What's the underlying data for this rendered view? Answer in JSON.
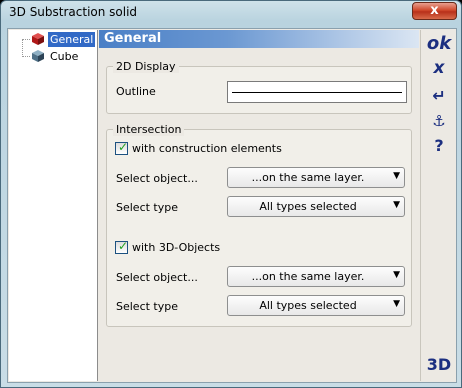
{
  "window": {
    "title": "3D Substraction solid",
    "close_label": "x"
  },
  "tree": {
    "items": [
      {
        "label": "General",
        "selected": true,
        "icon": "red-cube-icon"
      },
      {
        "label": "Cube",
        "selected": false,
        "icon": "blue-cube-icon"
      }
    ]
  },
  "panel": {
    "title": "General",
    "display_group": {
      "legend": "2D Display",
      "outline_label": "Outline"
    },
    "intersection_group": {
      "legend": "Intersection",
      "construction": {
        "checkbox_label": "with construction elements",
        "checked": true,
        "select_object_label": "Select object...",
        "select_object_value": "...on the same layer.",
        "select_type_label": "Select type",
        "select_type_value": "All types selected"
      },
      "objects3d": {
        "checkbox_label": "with 3D-Objects",
        "checked": true,
        "select_object_label": "Select object...",
        "select_object_value": "...on the same layer.",
        "select_type_label": "Select type",
        "select_type_value": "All types selected"
      }
    }
  },
  "toolbar": {
    "ok_label": "ok",
    "cancel_label": "x",
    "enter_icon": "↵",
    "anchor_icon": "⚓",
    "help_label": "?",
    "mode_label": "3D"
  },
  "colors": {
    "header_blue": "#4a7fc6",
    "toolbar_text": "#1c2f80",
    "selection": "#3169c6"
  }
}
